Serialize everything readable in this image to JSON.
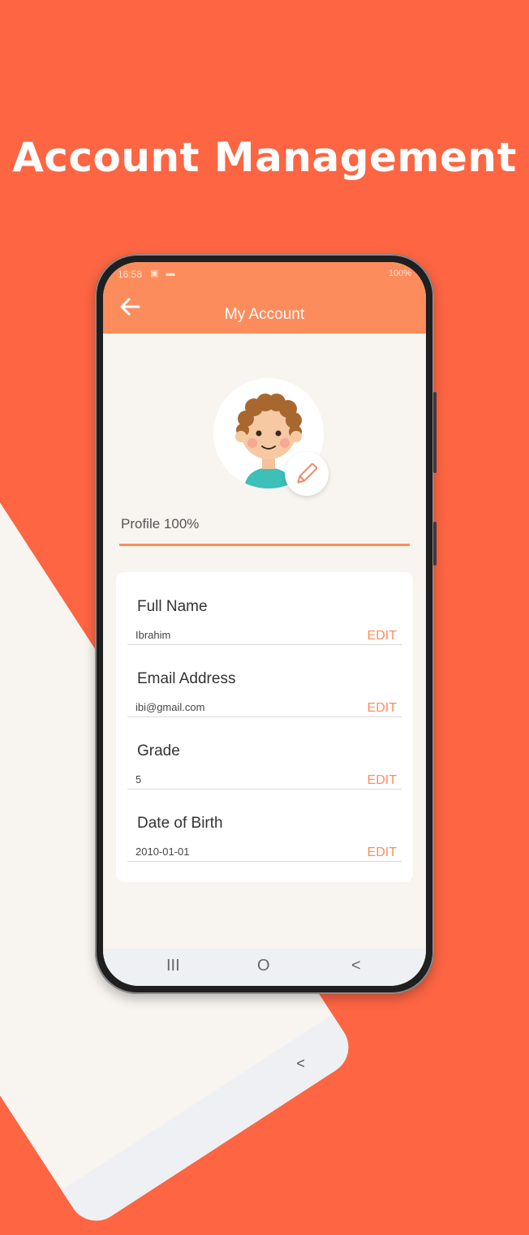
{
  "headline": "Account Management",
  "phone": {
    "status": {
      "time": "16:58",
      "icons": "▣ ▬",
      "right": "100%"
    },
    "appbar": {
      "title": "My Account",
      "back_icon": "arrow-left-icon"
    },
    "profile": {
      "label": "Profile 100%",
      "progress_percent": 100,
      "avatar_icon": "child-avatar-icon",
      "edit_icon": "pencil-icon"
    },
    "fields": [
      {
        "label": "Full Name",
        "value": "Ibrahim",
        "edit": "EDIT"
      },
      {
        "label": "Email Address",
        "value": "ibi@gmail.com",
        "edit": "EDIT"
      },
      {
        "label": "Grade",
        "value": "5",
        "edit": "EDIT"
      },
      {
        "label": "Date of Birth",
        "value": "2010-01-01",
        "edit": "EDIT"
      }
    ],
    "nav": {
      "recents": "III",
      "home": "O",
      "back": "<"
    }
  },
  "colors": {
    "background": "#fd6543",
    "appbar": "#fd8c5d",
    "accent": "#fd8c5d"
  }
}
